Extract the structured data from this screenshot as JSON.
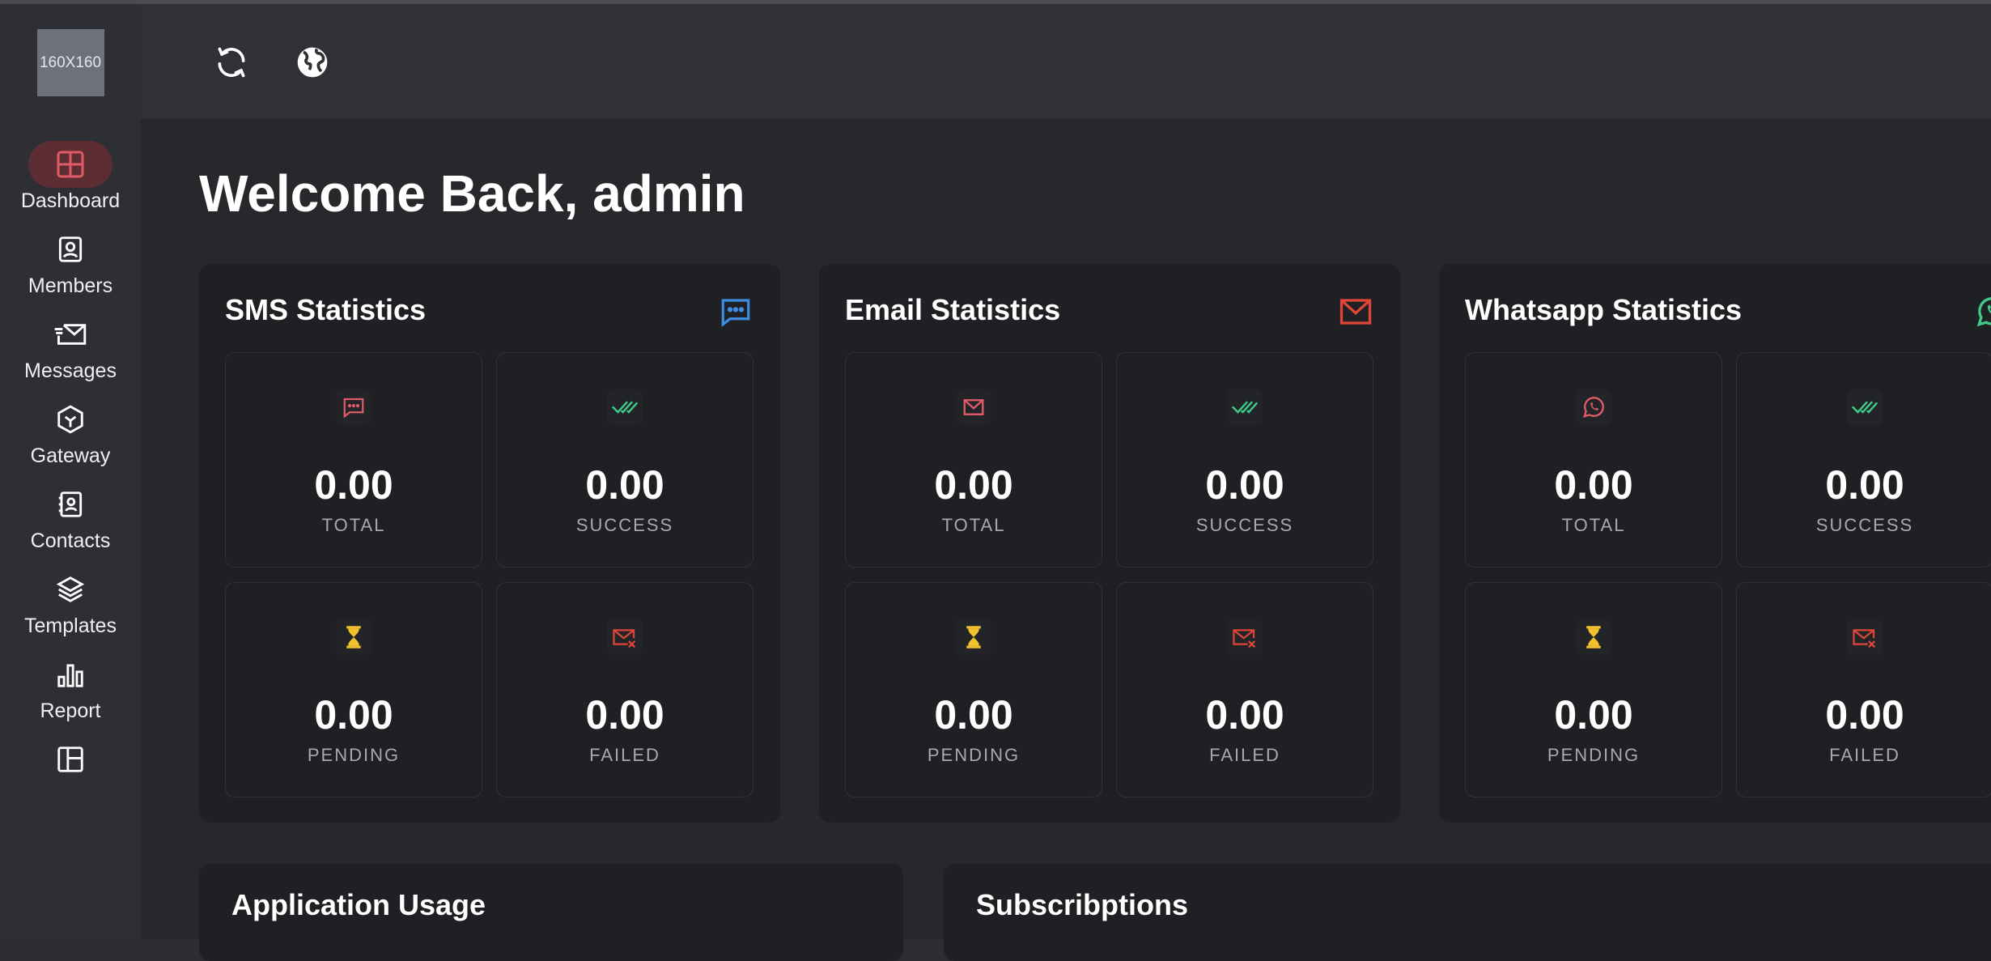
{
  "logo": {
    "text": "160X160"
  },
  "sidebar": {
    "items": [
      {
        "label": "Dashboard",
        "icon": "dashboard-icon",
        "active": true
      },
      {
        "label": "Members",
        "icon": "members-icon"
      },
      {
        "label": "Messages",
        "icon": "messages-icon"
      },
      {
        "label": "Gateway",
        "icon": "gateway-icon"
      },
      {
        "label": "Contacts",
        "icon": "contacts-icon"
      },
      {
        "label": "Templates",
        "icon": "templates-icon"
      },
      {
        "label": "Report",
        "icon": "report-icon"
      },
      {
        "label": "",
        "icon": "layout-icon"
      }
    ]
  },
  "topbar": {
    "icons": [
      "refresh-icon",
      "globe-icon"
    ]
  },
  "main": {
    "welcome": "Welcome Back, admin"
  },
  "panels": [
    {
      "title": "SMS Statistics",
      "icon": "sms-icon",
      "stats": [
        {
          "value": "0.00",
          "caption": "TOTAL"
        },
        {
          "value": "0.00",
          "caption": "SUCCESS"
        },
        {
          "value": "0.00",
          "caption": "PENDING"
        },
        {
          "value": "0.00",
          "caption": "FAILED"
        }
      ]
    },
    {
      "title": "Email Statistics",
      "icon": "email-icon",
      "stats": [
        {
          "value": "0.00",
          "caption": "TOTAL"
        },
        {
          "value": "0.00",
          "caption": "SUCCESS"
        },
        {
          "value": "0.00",
          "caption": "PENDING"
        },
        {
          "value": "0.00",
          "caption": "FAILED"
        }
      ]
    },
    {
      "title": "Whatsapp Statistics",
      "icon": "whatsapp-icon",
      "stats": [
        {
          "value": "0.00",
          "caption": "TOTAL"
        },
        {
          "value": "0.00",
          "caption": "SUCCESS"
        },
        {
          "value": "0.00",
          "caption": "PENDING"
        },
        {
          "value": "0.00",
          "caption": "FAILED"
        }
      ]
    }
  ],
  "bottom": {
    "application_usage": "Application Usage",
    "subscriptions": "Subscribptions"
  },
  "colors": {
    "accent_red": "#e05a68",
    "success_green": "#3fc98a",
    "pending_yellow": "#f2c12e",
    "failed_red": "#e0453a",
    "sms_blue": "#3d8ee0",
    "email_red": "#e0453a",
    "whatsapp_green": "#3fc98a"
  }
}
